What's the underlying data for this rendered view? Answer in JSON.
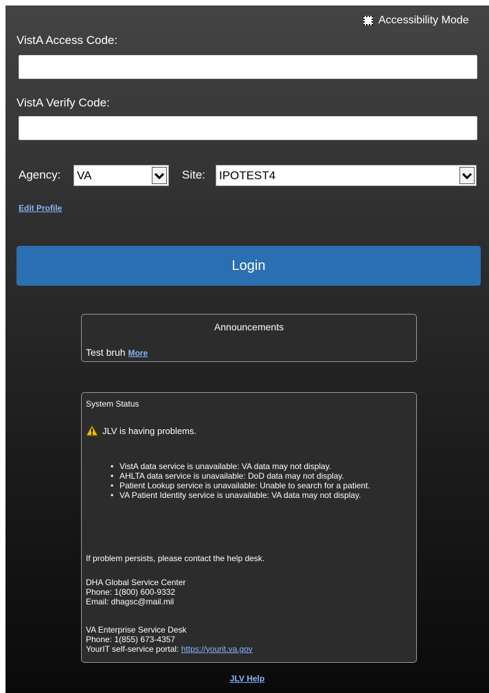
{
  "accessibility": {
    "label": "Accessibility Mode"
  },
  "access_code": {
    "label": "VistA Access Code:",
    "value": ""
  },
  "verify_code": {
    "label": "VistA Verify Code:",
    "value": ""
  },
  "agency": {
    "label": "Agency:",
    "selected": "VA"
  },
  "site": {
    "label": "Site:",
    "selected": "IPOTEST4"
  },
  "edit_profile": {
    "label": "Edit Profile"
  },
  "login": {
    "label": "Login"
  },
  "announcements": {
    "title": "Announcements",
    "text": "Test bruh",
    "more_label": "More"
  },
  "system_status": {
    "title": "System Status",
    "warning": "JLV is having problems.",
    "items": [
      "VistA data service is unavailable: VA data may not display.",
      "AHLTA data service is unavailable: DoD data may not display.",
      "Patient Lookup service is unavailable: Unable to search for a patient.",
      "VA Patient Identity service is unavailable: VA data may not display."
    ],
    "persist_text": "If problem persists, please contact the help desk.",
    "dha": {
      "name": "DHA Global Service Center",
      "phone": "Phone: 1(800) 600-9332",
      "email": "Email: dhagsc@mail.mil"
    },
    "va": {
      "name": "VA Enterprise Service Desk",
      "phone": "Phone: 1(855) 673-4357",
      "portal_prefix": "YourIT self-service portal:",
      "portal_link": "https://yourit.va.gov"
    }
  },
  "help": {
    "label": "JLV Help"
  },
  "colors": {
    "login_button": "#2b6fb3",
    "link": "#8ab4f8",
    "warning_icon": "#f2c200"
  }
}
